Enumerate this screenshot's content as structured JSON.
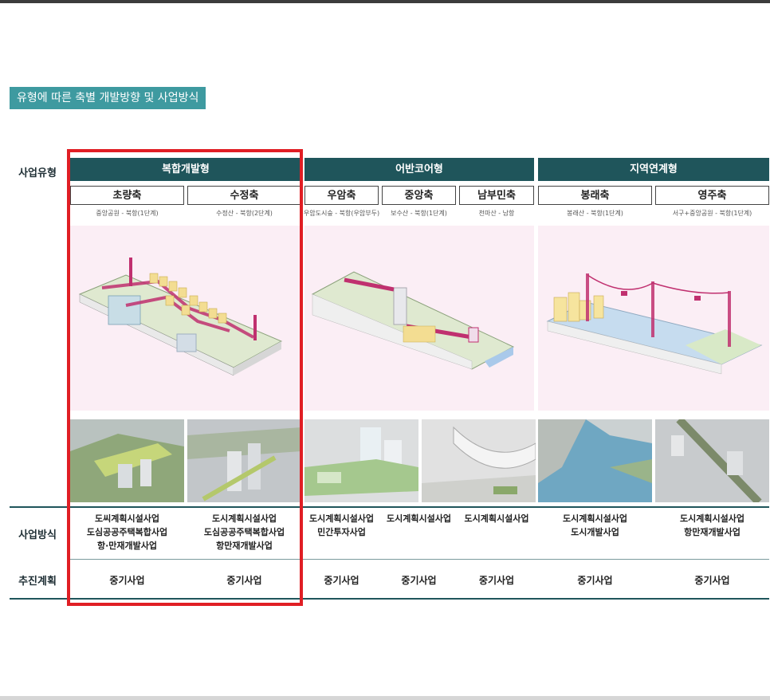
{
  "title": "유형에 따른 축별 개발방향 및 사업방식",
  "row_labels": {
    "type": "사업유형",
    "method": "사업방식",
    "plan": "추진계획"
  },
  "types": [
    {
      "name": "복합개발형"
    },
    {
      "name": "어반코어형"
    },
    {
      "name": "지역연계형"
    }
  ],
  "axes": [
    {
      "name": "초량축",
      "sub": "중앙공원 - 북항(1단계)",
      "method": [
        "도씨계획시설사업",
        "도심공공주택복합사업",
        "항·만재개발사업"
      ],
      "plan": "중기사업"
    },
    {
      "name": "수정축",
      "sub": "수정산 - 북항(2단계)",
      "method": [
        "도시계획시설사업",
        "도심공공주택복합사업",
        "항만재개발사업"
      ],
      "plan": "중기사업"
    },
    {
      "name": "우암축",
      "sub": "우암도시숲 - 북항(우암부두)",
      "method": [
        "도시계획시설사업",
        "민간투자사업"
      ],
      "plan": "중기사업"
    },
    {
      "name": "중앙축",
      "sub": "보수산 - 북항(1단계)",
      "method": [
        "도시계획시설사업"
      ],
      "plan": "중기사업"
    },
    {
      "name": "남부민축",
      "sub": "천마산 - 남항",
      "method": [
        "도시계획시설사업"
      ],
      "plan": "중기사업"
    },
    {
      "name": "봉래축",
      "sub": "봉래산 - 북항(1단계)",
      "method": [
        "도시계획시설사업",
        "도시개발사업"
      ],
      "plan": "중기사업"
    },
    {
      "name": "영주축",
      "sub": "서구+중앙공원 - 북항(1단계)",
      "method": [
        "도시계획시설사업",
        "항만재개발사업"
      ],
      "plan": "중기사업"
    }
  ],
  "colors": {
    "header_bg": "#1f555b",
    "title_bg": "#3e9aa0",
    "panel_bg": "#fbeef5",
    "highlight": "#e01e24",
    "accent_pink": "#c0306f"
  },
  "icons": {
    "diagram_mixed": "isometric-terrain-diagram",
    "diagram_urban": "isometric-skybridge-diagram",
    "diagram_regional": "isometric-cable-car-diagram"
  }
}
